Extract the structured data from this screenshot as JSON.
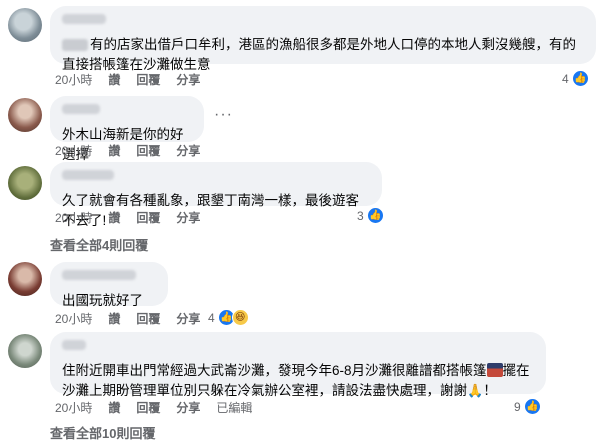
{
  "comments": [
    {
      "text": "有的店家出借戶口牟利，港區的漁船很多都是外地人口停的本地人剩沒幾艘，有的直接搭帳篷在沙灘做生意",
      "time": "20小時",
      "like": "讚",
      "reply": "回覆",
      "share": "分享",
      "reaction_count": "4"
    },
    {
      "text": "外木山海新是你的好選擇",
      "time": "20小時",
      "like": "讚",
      "reply": "回覆",
      "share": "分享",
      "more": "···"
    },
    {
      "text": "久了就會有各種亂象，跟墾丁南灣一樣，最後遊客不去了!",
      "time": "20小時",
      "like": "讚",
      "reply": "回覆",
      "share": "分享",
      "reaction_count": "3",
      "view_replies": "查看全部4則回覆"
    },
    {
      "text": "出國玩就好了",
      "time": "20小時",
      "like": "讚",
      "reply": "回覆",
      "share": "分享",
      "reaction_count": "4"
    },
    {
      "text_part1": "住附近開車出門常經過大武崙沙灘，發現今年6-8月沙灘很離譜都搭帳篷",
      "text_part2": "擺在沙灘上期盼管理單位別只躲在冷氣辦公室裡，請設法盡快處理，謝謝",
      "text_part3": "！",
      "time": "20小時",
      "like": "讚",
      "reply": "回覆",
      "share": "分享",
      "edited": "已編輯",
      "reaction_count": "9",
      "view_replies": "查看全部10則回覆"
    }
  ],
  "icons": {
    "like": "thumbs-up-icon",
    "haha": "laughing-face-icon",
    "pray": "folded-hands-icon",
    "tent": "tent-emoji-icon"
  }
}
